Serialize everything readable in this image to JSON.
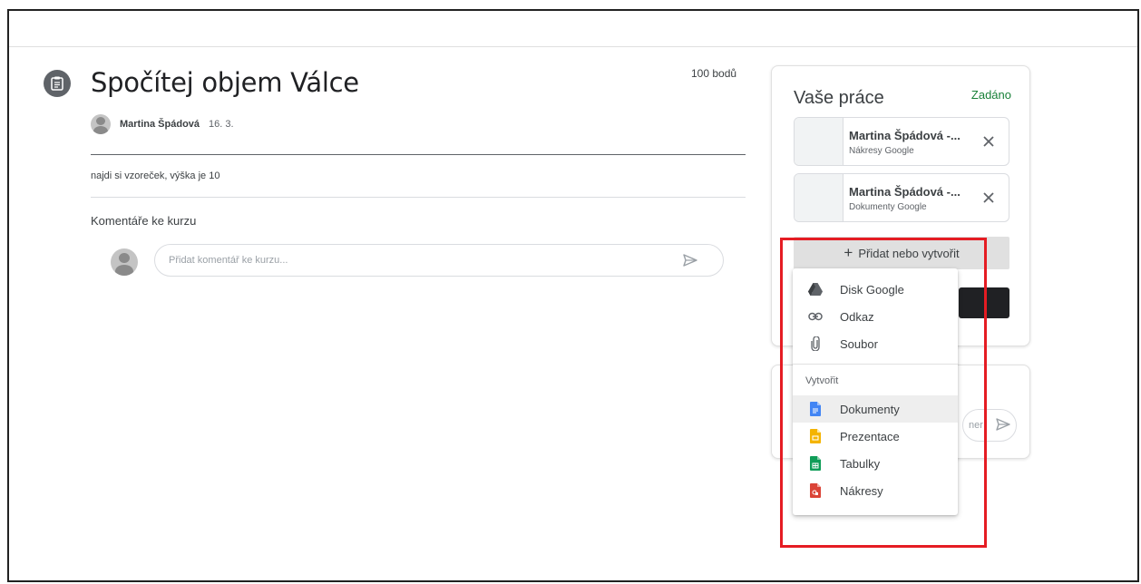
{
  "assignment": {
    "title": "Spočítej objem Válce",
    "points": "100 bodů",
    "author": "Martina Špádová",
    "date": "16. 3.",
    "description": "najdi si vzoreček, výška je 10",
    "icon": "assignment-icon"
  },
  "comments": {
    "title": "Komentáře ke kurzu",
    "placeholder": "Přidat komentář ke kurzu..."
  },
  "work": {
    "title": "Vaše práce",
    "status": "Zadáno",
    "status_color": "#188038",
    "attachments": [
      {
        "name": "Martina Špádová -...",
        "type": "Nákresy Google"
      },
      {
        "name": "Martina Špádová -...",
        "type": "Dokumenty Google"
      }
    ],
    "add_button": "Přidat nebo vytvořit",
    "add_icon": "+"
  },
  "private_comment": {
    "fragment": "ner"
  },
  "menu": {
    "items": [
      {
        "label": "Disk Google",
        "icon": "drive-icon"
      },
      {
        "label": "Odkaz",
        "icon": "link-icon"
      },
      {
        "label": "Soubor",
        "icon": "paperclip-icon"
      }
    ],
    "section_label": "Vytvořit",
    "create_items": [
      {
        "label": "Dokumenty",
        "icon": "docs-icon",
        "color": "#4285f4"
      },
      {
        "label": "Prezentace",
        "icon": "slides-icon",
        "color": "#f4b400"
      },
      {
        "label": "Tabulky",
        "icon": "sheets-icon",
        "color": "#0f9d58"
      },
      {
        "label": "Nákresy",
        "icon": "drawings-icon",
        "color": "#db4437"
      }
    ]
  },
  "highlight_color": "#e51c23"
}
